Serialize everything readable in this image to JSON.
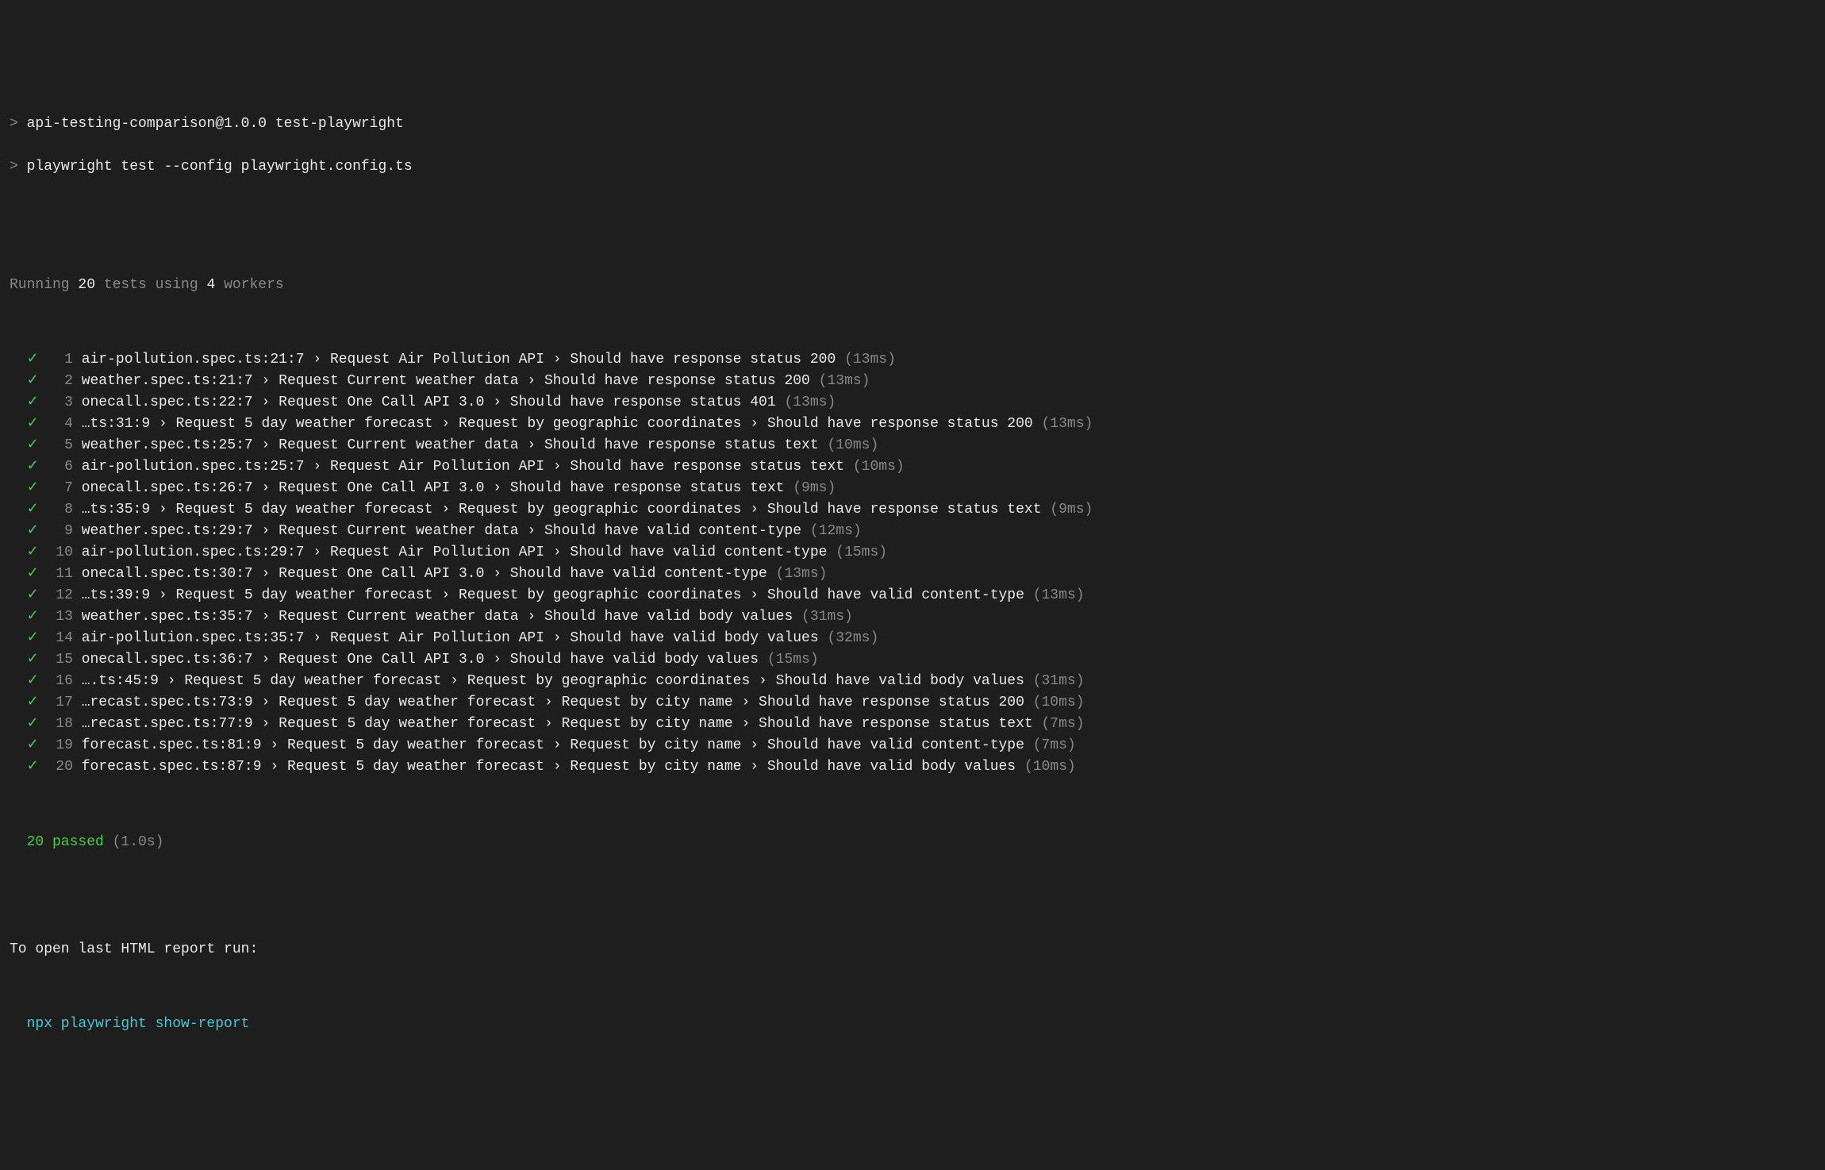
{
  "header": {
    "line1_prompt": "> ",
    "line1_text": "api-testing-comparison@1.0.0 test-playwright",
    "line2_prompt": "> ",
    "line2_text": "playwright test --config playwright.config.ts"
  },
  "running": {
    "prefix": "Running ",
    "count": "20",
    "mid": " tests using ",
    "workers": "4",
    "suffix": " workers"
  },
  "tests": [
    {
      "idx": "1",
      "desc": "air-pollution.spec.ts:21:7 › Request Air Pollution API › Should have response status 200",
      "time": "(13ms)"
    },
    {
      "idx": "2",
      "desc": "weather.spec.ts:21:7 › Request Current weather data › Should have response status 200",
      "time": "(13ms)"
    },
    {
      "idx": "3",
      "desc": "onecall.spec.ts:22:7 › Request One Call API 3.0 › Should have response status 401",
      "time": "(13ms)"
    },
    {
      "idx": "4",
      "desc": "…ts:31:9 › Request 5 day weather forecast › Request by geographic coordinates › Should have response status 200",
      "time": "(13ms)"
    },
    {
      "idx": "5",
      "desc": "weather.spec.ts:25:7 › Request Current weather data › Should have response status text",
      "time": "(10ms)"
    },
    {
      "idx": "6",
      "desc": "air-pollution.spec.ts:25:7 › Request Air Pollution API › Should have response status text",
      "time": "(10ms)"
    },
    {
      "idx": "7",
      "desc": "onecall.spec.ts:26:7 › Request One Call API 3.0 › Should have response status text",
      "time": "(9ms)"
    },
    {
      "idx": "8",
      "desc": "…ts:35:9 › Request 5 day weather forecast › Request by geographic coordinates › Should have response status text",
      "time": "(9ms)"
    },
    {
      "idx": "9",
      "desc": "weather.spec.ts:29:7 › Request Current weather data › Should have valid content-type",
      "time": "(12ms)"
    },
    {
      "idx": "10",
      "desc": "air-pollution.spec.ts:29:7 › Request Air Pollution API › Should have valid content-type",
      "time": "(15ms)"
    },
    {
      "idx": "11",
      "desc": "onecall.spec.ts:30:7 › Request One Call API 3.0 › Should have valid content-type",
      "time": "(13ms)"
    },
    {
      "idx": "12",
      "desc": "…ts:39:9 › Request 5 day weather forecast › Request by geographic coordinates › Should have valid content-type",
      "time": "(13ms)"
    },
    {
      "idx": "13",
      "desc": "weather.spec.ts:35:7 › Request Current weather data › Should have valid body values",
      "time": "(31ms)"
    },
    {
      "idx": "14",
      "desc": "air-pollution.spec.ts:35:7 › Request Air Pollution API › Should have valid body values",
      "time": "(32ms)"
    },
    {
      "idx": "15",
      "desc": "onecall.spec.ts:36:7 › Request One Call API 3.0 › Should have valid body values",
      "time": "(15ms)"
    },
    {
      "idx": "16",
      "desc": "….ts:45:9 › Request 5 day weather forecast › Request by geographic coordinates › Should have valid body values",
      "time": "(31ms)"
    },
    {
      "idx": "17",
      "desc": "…recast.spec.ts:73:9 › Request 5 day weather forecast › Request by city name › Should have response status 200",
      "time": "(10ms)"
    },
    {
      "idx": "18",
      "desc": "…recast.spec.ts:77:9 › Request 5 day weather forecast › Request by city name › Should have response status text",
      "time": "(7ms)"
    },
    {
      "idx": "19",
      "desc": "forecast.spec.ts:81:9 › Request 5 day weather forecast › Request by city name › Should have valid content-type",
      "time": "(7ms)"
    },
    {
      "idx": "20",
      "desc": "forecast.spec.ts:87:9 › Request 5 day weather forecast › Request by city name › Should have valid body values",
      "time": "(10ms)"
    }
  ],
  "summary": {
    "passed": "20 passed",
    "time": "(1.0s)"
  },
  "footer": {
    "hint": "To open last HTML report run:",
    "command": "npx playwright show-report"
  },
  "check_symbol": "✓"
}
